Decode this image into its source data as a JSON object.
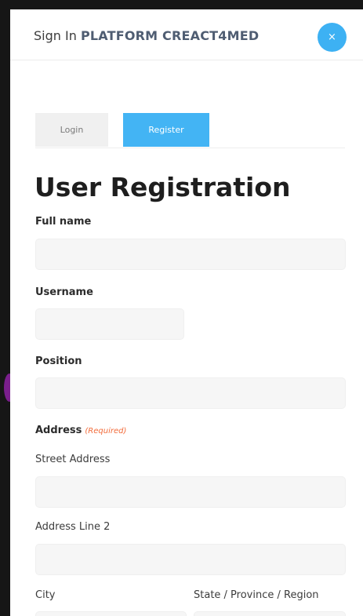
{
  "modal": {
    "title_prefix": "Sign In",
    "title_brand": "PLATFORM CREACT4MED",
    "close_glyph": "×"
  },
  "tabs": [
    {
      "label": "Login",
      "active": false
    },
    {
      "label": "Register",
      "active": true
    }
  ],
  "form": {
    "title": "User Registration",
    "full_name": {
      "label": "Full name",
      "value": "",
      "placeholder": ""
    },
    "username": {
      "label": "Username",
      "value": "",
      "placeholder": ""
    },
    "position": {
      "label": "Position",
      "value": "",
      "placeholder": ""
    },
    "address": {
      "label": "Address",
      "required_note": "(Required)",
      "street": {
        "label": "Street Address",
        "value": "",
        "placeholder": ""
      },
      "line2": {
        "label": "Address Line 2",
        "value": "",
        "placeholder": ""
      },
      "city": {
        "label": "City",
        "value": "",
        "placeholder": ""
      },
      "state": {
        "label": "State / Province / Region",
        "value": "",
        "placeholder": ""
      }
    }
  },
  "colors": {
    "accent": "#43b4f4",
    "close_button": "#3db1f3",
    "required": "#f26b3a",
    "backdrop": "#161616"
  },
  "icons": {
    "close": "close-icon"
  }
}
